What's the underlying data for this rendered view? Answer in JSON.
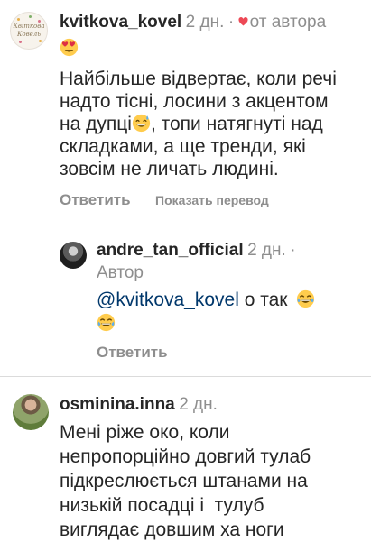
{
  "comments": [
    {
      "username": "kvitkova_kovel",
      "time": "2 дн.",
      "separator": "·",
      "liked_by_author_label": "от автора",
      "avatar_text": "Квіткова Ковель",
      "text_lines": [
        "Найбільше відвертає, коли речі",
        "надто тісні, лосини з акцентом",
        "на дупці",
        ", топи натягнуті над",
        "складками, а ще тренди, які",
        "зовсім не личать людині."
      ],
      "reply_label": "Ответить",
      "translate_label": "Показать перевод"
    },
    {
      "username": "andre_tan_official",
      "time": "2 дн.",
      "separator": "·",
      "badge": "Автор",
      "mention": "@kvitkova_kovel",
      "text": " о так",
      "reply_label": "Ответить"
    },
    {
      "username": "osminina.inna",
      "time": "2 дн.",
      "text_lines": [
        "Мені ріже око, коли",
        "непропорційно довгий тулаб",
        "підкреслюється штанами на",
        "низькій посадці і  тулуб",
        "виглядає довшим ха ноги"
      ]
    }
  ],
  "icons": {
    "heart": "heart-icon",
    "heart_eyes": "heart-eyes-emoji",
    "sweat_smile": "sweat-smile-emoji",
    "laughing": "tears-of-joy-emoji"
  },
  "colors": {
    "heart": "#ed4956",
    "mention": "#00376b",
    "secondary": "#8e8e8e",
    "primary": "#262626"
  }
}
